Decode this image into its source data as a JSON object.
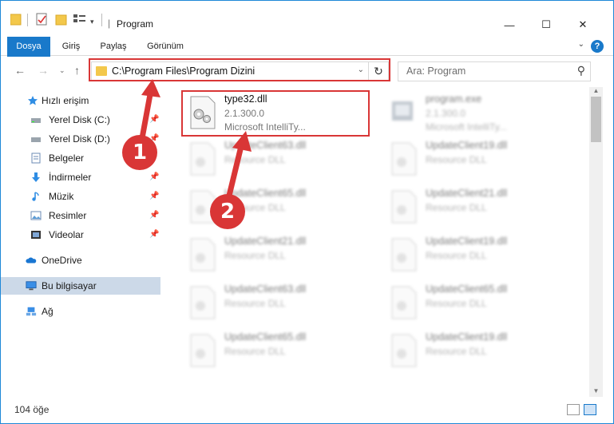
{
  "window": {
    "title": "Program",
    "controls": {
      "minimize": "—",
      "maximize": "☐",
      "close": "✕"
    }
  },
  "ribbon": {
    "tabs": [
      "Dosya",
      "Giriş",
      "Paylaş",
      "Görünüm"
    ],
    "help": "?"
  },
  "navigation": {
    "address_path": "C:\\Program Files\\Program Dizini",
    "search_placeholder": "Ara: Program"
  },
  "sidebar": {
    "items": [
      {
        "label": "Hızlı erişim",
        "icon": "star-icon"
      },
      {
        "label": "Yerel Disk (C:)",
        "icon": "drive-icon"
      },
      {
        "label": "Yerel Disk (D:)",
        "icon": "drive-icon"
      },
      {
        "label": "Belgeler",
        "icon": "documents-icon"
      },
      {
        "label": "İndirmeler",
        "icon": "download-icon"
      },
      {
        "label": "Müzik",
        "icon": "music-icon"
      },
      {
        "label": "Resimler",
        "icon": "pictures-icon"
      },
      {
        "label": "Videolar",
        "icon": "videos-icon"
      },
      {
        "label": "OneDrive",
        "icon": "cloud-icon"
      },
      {
        "label": "Bu bilgisayar",
        "icon": "computer-icon"
      },
      {
        "label": "Ağ",
        "icon": "network-icon"
      }
    ]
  },
  "files": [
    {
      "name": "type32.dll",
      "version": "2.1.300.0",
      "description": "Microsoft IntelliTy...",
      "highlighted": true
    },
    {
      "name": "program.exe",
      "version": "2.1.300.0",
      "description": "Microsoft IntelliTy..."
    },
    {
      "name": "UpdateClient63.dll",
      "description": "Resource DLL"
    },
    {
      "name": "UpdateClient19.dll",
      "description": "Resource DLL"
    },
    {
      "name": "UpdateClient65.dll",
      "description": "Resource DLL"
    },
    {
      "name": "UpdateClient21.dll",
      "description": "Resource DLL"
    },
    {
      "name": "UpdateClient21.dll",
      "description": "Resource DLL"
    },
    {
      "name": "UpdateClient19.dll",
      "description": "Resource DLL"
    },
    {
      "name": "UpdateClient63.dll",
      "description": "Resource DLL"
    },
    {
      "name": "UpdateClient65.dll",
      "description": "Resource DLL"
    },
    {
      "name": "UpdateClient65.dll",
      "description": "Resource DLL"
    },
    {
      "name": "UpdateClient19.dll",
      "description": "Resource DLL"
    }
  ],
  "status": {
    "item_count": "104 öğe"
  },
  "annotations": {
    "step1": "1",
    "step2": "2",
    "color": "#d93636"
  }
}
